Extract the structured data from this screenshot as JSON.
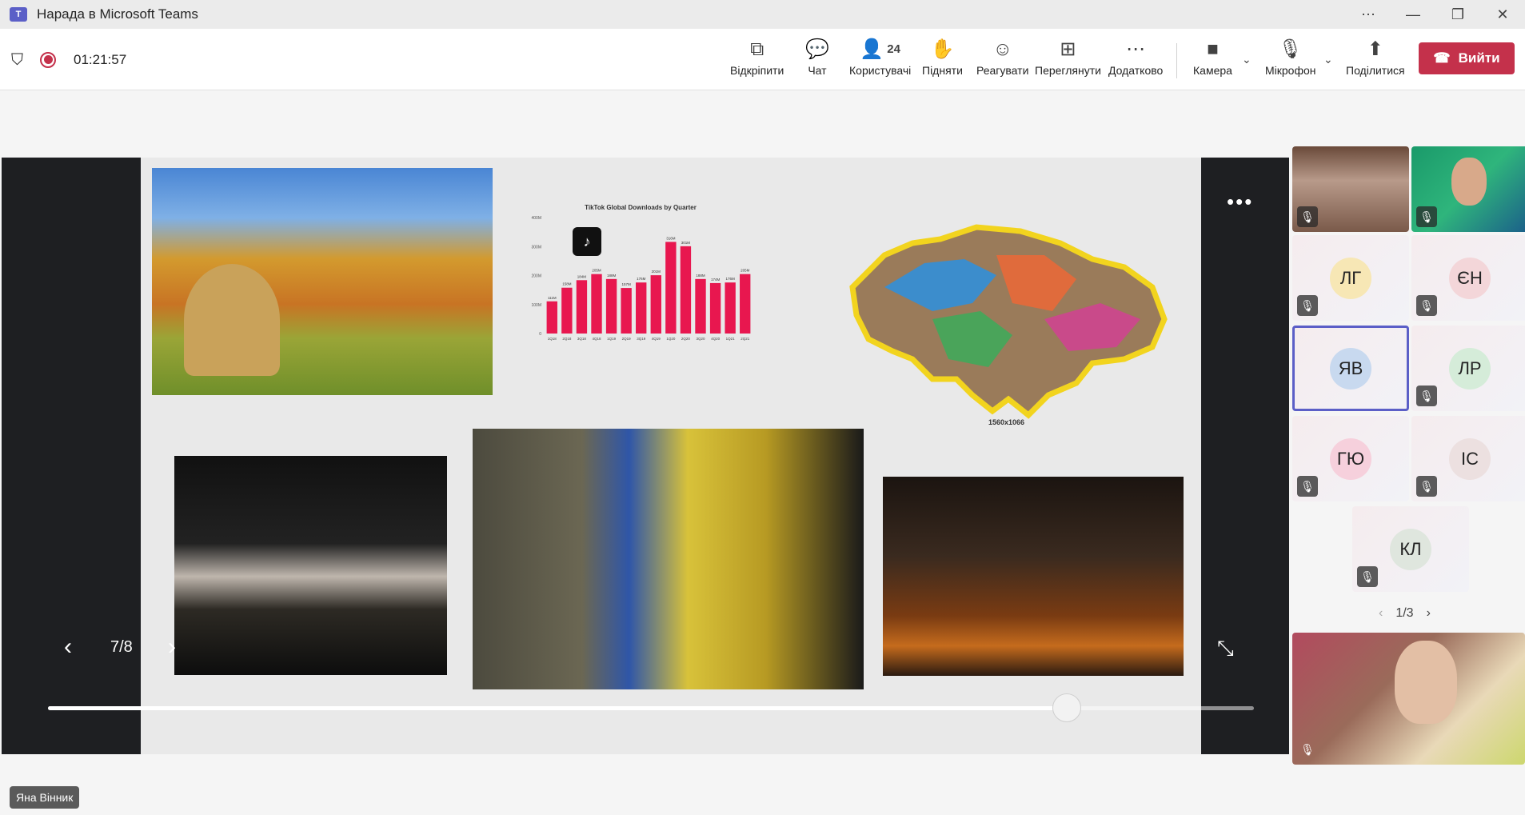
{
  "window": {
    "title": "Нарада в Microsoft Teams",
    "app_icon": "teams-icon",
    "controls": [
      "more",
      "minimize",
      "restore",
      "close"
    ]
  },
  "toolbar": {
    "timer": "01:21:57",
    "buttons": [
      {
        "label": "Відкріпити",
        "icon": "pop-out-icon"
      },
      {
        "label": "Чат",
        "icon": "chat-icon"
      },
      {
        "label": "Користувачі",
        "icon": "people-icon",
        "count": "24"
      },
      {
        "label": "Підняти",
        "icon": "raise-hand-icon"
      },
      {
        "label": "Реагувати",
        "icon": "react-icon"
      },
      {
        "label": "Переглянути",
        "icon": "view-icon"
      },
      {
        "label": "Додатково",
        "icon": "more-icon"
      },
      {
        "label": "Камера",
        "icon": "camera-icon"
      },
      {
        "label": "Мікрофон",
        "icon": "mic-off-icon"
      },
      {
        "label": "Поділитися",
        "icon": "share-icon"
      }
    ],
    "leave_label": "Вийти",
    "accent_leave": "#c4314b"
  },
  "stage": {
    "page_indicator": "7/8",
    "slider_position": 0.845,
    "slide": {
      "chart_title": "TikTok Global Downloads by Quarter",
      "map_caption": "1560x1066"
    }
  },
  "chart_data": {
    "type": "bar",
    "title": "TikTok Global Downloads by Quarter",
    "categories": [
      "1Q18",
      "2Q18",
      "3Q18",
      "4Q18",
      "1Q19",
      "2Q19",
      "3Q19",
      "4Q19",
      "1Q20",
      "2Q20",
      "3Q20",
      "4Q20",
      "1Q21",
      "2Q21"
    ],
    "values": [
      111,
      158,
      184,
      205,
      188,
      157,
      176,
      201,
      316,
      301,
      188,
      174,
      176,
      205
    ],
    "value_labels": [
      "111M",
      "158M",
      "184M",
      "205M",
      "188M",
      "157M",
      "176M",
      "201M",
      "316M",
      "301M",
      "188M",
      "174M",
      "176M",
      "205M"
    ],
    "yticks": [
      "0",
      "100M",
      "200M",
      "300M",
      "400M"
    ],
    "ylim": [
      0,
      400
    ],
    "color": "#e8174f"
  },
  "participants": {
    "tiles": [
      {
        "initials": "",
        "video": true
      },
      {
        "initials": "",
        "video": true
      },
      {
        "initials": "ЛГ",
        "color": "#f7e7b5"
      },
      {
        "initials": "ЄН",
        "color": "#f3d6d9"
      },
      {
        "initials": "ЯВ",
        "color": "#c8d9ef",
        "active": true
      },
      {
        "initials": "ЛР",
        "color": "#d5ecd9"
      },
      {
        "initials": "ГЮ",
        "color": "#f6d0dc"
      },
      {
        "initials": "ІС",
        "color": "#ece0e0"
      },
      {
        "initials": "КЛ",
        "color": "#dfe6de"
      }
    ],
    "pager": "1/3"
  },
  "self": {
    "name": "Яна Вінник"
  }
}
